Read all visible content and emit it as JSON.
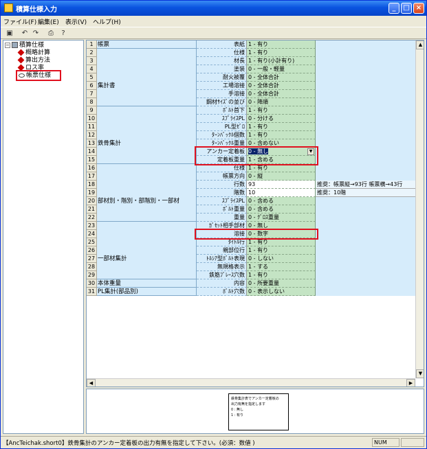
{
  "window": {
    "title": "積算仕様入力"
  },
  "menu": [
    "ファイル(F)",
    "編集(E)",
    "表示(V)",
    "ヘルプ(H)"
  ],
  "toolbar": {
    "icons": [
      "save-icon",
      "undo-icon",
      "redo-icon",
      "print-icon",
      "help-icon"
    ]
  },
  "tree": {
    "root": "積算仕様",
    "items": [
      "概略計算",
      "算出方法",
      "ロス率",
      "帳票仕様"
    ],
    "selected": "帳票仕様"
  },
  "grid": {
    "groups": [
      {
        "label": "帳票",
        "start": 1,
        "span": 1
      },
      {
        "label": "集計書",
        "start": 2,
        "span": 7
      },
      {
        "label": "鉄骨集計",
        "start": 9,
        "span": 7
      },
      {
        "label": "部材別・階別・部階別・一部材",
        "start": 16,
        "span": 7
      },
      {
        "label": "一部材集計",
        "start": 23,
        "span": 7
      },
      {
        "label": "本体重量",
        "start": 30,
        "span": 1
      },
      {
        "label": "PL集計(部品別)",
        "start": 31,
        "span": 1
      }
    ],
    "rows": [
      {
        "n": "1",
        "item": "表紙",
        "value": "1 - 有り"
      },
      {
        "n": "2",
        "item": "仕様",
        "value": "1 - 有り"
      },
      {
        "n": "3",
        "item": "材長",
        "value": "1 - 有り(小計有り)"
      },
      {
        "n": "4",
        "item": "塗装",
        "value": "0 - 一般・軽量"
      },
      {
        "n": "5",
        "item": "耐火被覆",
        "value": "0 - 全体合計"
      },
      {
        "n": "6",
        "item": "工場溶接",
        "value": "0 - 全体合計"
      },
      {
        "n": "7",
        "item": "手溶接",
        "value": "0 - 全体合計"
      },
      {
        "n": "8",
        "item": "鋼材ｻｲｽﾞの並び",
        "value": "0 - 降順"
      },
      {
        "n": "9",
        "item": "ﾎﾞﾙﾄ首下",
        "value": "1 - 有り"
      },
      {
        "n": "10",
        "item": "ｽﾌﾟﾗｲｽPL",
        "value": "0 - 分ける"
      },
      {
        "n": "11",
        "item": "PL型ｾﾞﾛ",
        "value": "1 - 有り"
      },
      {
        "n": "12",
        "item": "ﾀｰﾝﾊﾞｯｸﾙ個数",
        "value": "1 - 有り"
      },
      {
        "n": "13",
        "item": "ﾀｰﾝﾊﾞｯｸﾙ重量",
        "value": "0 - 含めない"
      },
      {
        "n": "14",
        "item": "アンカー定着板",
        "value": "0 - 無し",
        "editing": true
      },
      {
        "n": "15",
        "item": "定着板重量",
        "value": "1 - 含める"
      },
      {
        "n": "16",
        "item": "仕様",
        "value": "1 - 有り"
      },
      {
        "n": "17",
        "item": "帳票方向",
        "value": "0 - 縦"
      },
      {
        "n": "18",
        "item": "行数",
        "value": "93",
        "white": true,
        "note": "推奨：帳票縦→93行 帳票横→43行"
      },
      {
        "n": "19",
        "item": "階数",
        "value": "10",
        "white": true,
        "note": "推奨：10階"
      },
      {
        "n": "20",
        "item": "ｽﾌﾟﾗｲｽPL",
        "value": "0 - 含める"
      },
      {
        "n": "21",
        "item": "ﾎﾞﾙﾄ重量",
        "value": "0 - 含める"
      },
      {
        "n": "22",
        "item": "重量",
        "value": "0 - ｸﾞﾛｽ重量"
      },
      {
        "n": "23",
        "item": "ｶﾞｾｯﾄ相手部材",
        "value": "0 - 無し"
      },
      {
        "n": "24",
        "item": "溶接",
        "value": "0 - 数字"
      },
      {
        "n": "25",
        "item": "ﾀｲﾄﾙ行",
        "value": "1 - 有り"
      },
      {
        "n": "26",
        "item": "親部位行",
        "value": "1 - 有り"
      },
      {
        "n": "27",
        "item": "ﾄﾙｼｱ型ﾎﾞﾙﾄ表現",
        "value": "0 - しない"
      },
      {
        "n": "28",
        "item": "無規格表示",
        "value": "1 - する"
      },
      {
        "n": "29",
        "item": "鉄筋ﾌﾞﾚｰｽ穴数",
        "value": "1 - 有り"
      },
      {
        "n": "30",
        "item": "内容",
        "value": "0 - 所要重量"
      },
      {
        "n": "31",
        "item": "ﾎﾞﾙﾄ穴数",
        "value": "0 - 表示しない"
      }
    ]
  },
  "help_card": {
    "lines": [
      "鉄骨集計表でアンカー定着板の",
      "出力有無を指定します",
      "0 : 無し",
      "1 : 有り"
    ]
  },
  "status": {
    "message": "【AncTeichak.short0】鉄骨集計のアンカー定着板の出力有無を指定して下さい。(必須：数値 )",
    "num": "NUM"
  },
  "colors": {
    "highlight": "#e0101e",
    "value_bg": "#c4e4c4",
    "label_bg": "#d6ecfb"
  }
}
